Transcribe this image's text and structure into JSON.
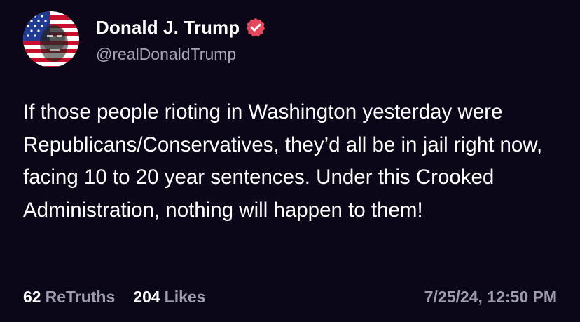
{
  "author": {
    "display_name": "Donald J. Trump",
    "handle": "@realDonaldTrump",
    "verified_icon": "verified-badge-icon",
    "avatar_icon": "american-flag-portrait-avatar"
  },
  "post": {
    "text": "If those people rioting in Washington yesterday were Republicans/Conservatives, they’d all be in jail right now, facing 10 to 20 year sentences. Under this Crooked Administration, nothing will happen to them!"
  },
  "stats": {
    "retruths_count": "62",
    "retruths_label": "ReTruths",
    "likes_count": "204",
    "likes_label": "Likes"
  },
  "timestamp": "7/25/24, 12:50 PM",
  "colors": {
    "background": "#0c0718",
    "verified_badge": "#e2485f",
    "secondary_text": "#9f9cb0"
  }
}
